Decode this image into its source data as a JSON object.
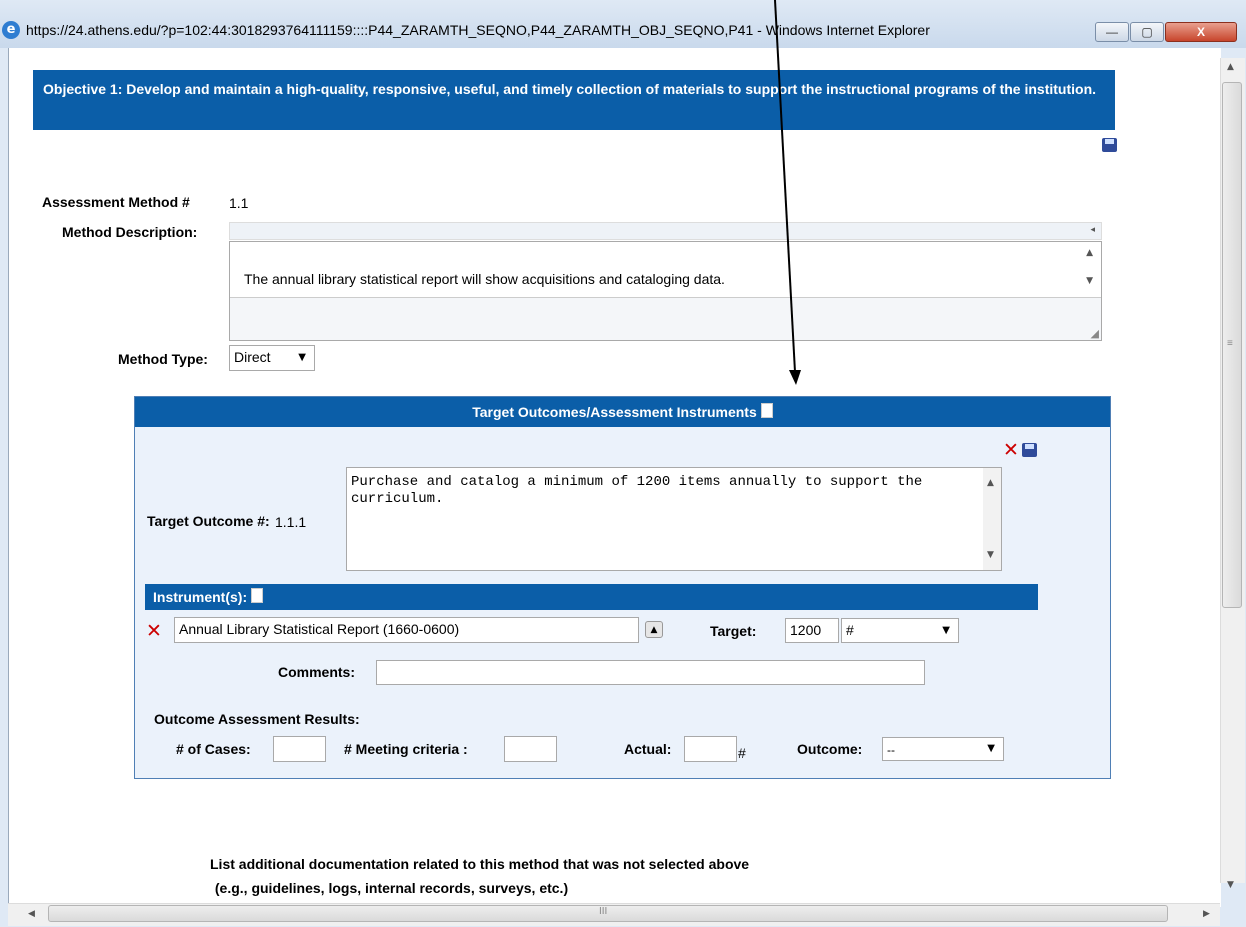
{
  "window": {
    "title": "https://24.athens.edu/?p=102:44:3018293764111159::::P44_ZARAMTH_SEQNO,P44_ZARAMTH_OBJ_SEQNO,P41 - Windows Internet Explorer",
    "minimize": "—",
    "restore": "▢",
    "close": "X"
  },
  "objective": {
    "text": "Objective 1: Develop and maintain a high-quality, responsive, useful, and timely collection of materials to support the instructional programs of the institution."
  },
  "assessment": {
    "method_label": "Assessment Method #",
    "method_number": "1.1",
    "description_label": "Method Description:",
    "description_text": "The annual library statistical report will show acquisitions and cataloging data.",
    "type_label": "Method Type:",
    "type_value": "Direct"
  },
  "target_panel": {
    "header": "Target Outcomes/Assessment Instruments",
    "outcome_label": "Target Outcome #:",
    "outcome_number": "1.1.1",
    "outcome_text": "Purchase and catalog a minimum of 1200 items annually to support the curriculum.",
    "instruments_label": "Instrument(s):",
    "instrument_value": "Annual Library Statistical Report (1660-0600)",
    "target_label": "Target:",
    "target_value": "1200",
    "target_unit": "#",
    "comments_label": "Comments:",
    "comments_value": "",
    "results_label": "Outcome Assessment Results:",
    "cases_label": "# of Cases:",
    "cases_value": "",
    "meeting_label": "# Meeting criteria :",
    "meeting_value": "",
    "actual_label": "Actual:",
    "actual_value": "",
    "actual_unit": "#",
    "outcome_label2": "Outcome:",
    "outcome_value": "--"
  },
  "additional_docs": {
    "line1": "List additional documentation related to this method that was not selected above",
    "line2": " (e.g., guidelines, logs, internal records, surveys, etc.)"
  },
  "scrollbar": {
    "h_grip": "III"
  }
}
